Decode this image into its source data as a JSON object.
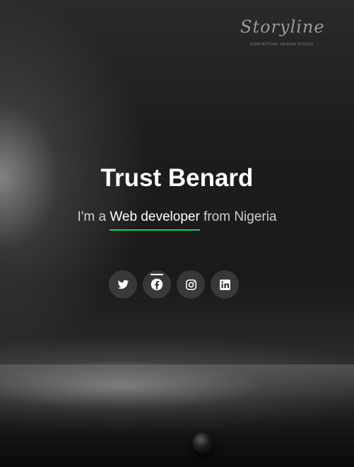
{
  "logo": {
    "name": "Storyline",
    "tagline": "CONCEPTUAL DESIGN STUDIO"
  },
  "hero": {
    "name": "Trust Benard",
    "intro_prefix": "I'm a ",
    "role": "Web developer",
    "intro_suffix": " from Nigeria"
  },
  "socials": [
    {
      "icon": "twitter-icon"
    },
    {
      "icon": "facebook-icon"
    },
    {
      "icon": "instagram-icon"
    },
    {
      "icon": "linkedin-icon"
    }
  ],
  "colors": {
    "accent": "#21c66d",
    "text": "#ffffff"
  }
}
